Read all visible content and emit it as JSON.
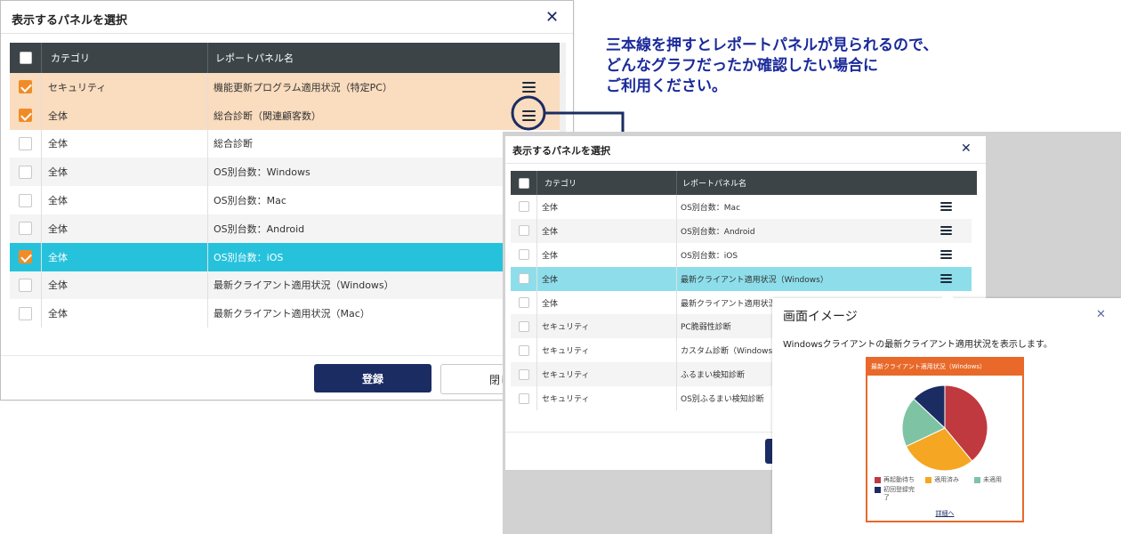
{
  "annotation": {
    "line1": "三本線を押すとレポートパネルが見られるので、",
    "line2": "どんなグラフだったか確認したい場合に",
    "line3": "ご利用ください。",
    "color": "#1a2a9a"
  },
  "dialog1": {
    "title": "表示するパネルを選択",
    "header_category": "カテゴリ",
    "header_name": "レポートパネル名",
    "rows": [
      {
        "category": "セキュリティ",
        "name": "機能更新プログラム適用状況（特定PC）",
        "checked": true
      },
      {
        "category": "全体",
        "name": "総合診断（関連顧客数）",
        "checked": true
      },
      {
        "category": "全体",
        "name": "総合診断",
        "checked": false
      },
      {
        "category": "全体",
        "name": "OS別台数：Windows",
        "checked": false
      },
      {
        "category": "全体",
        "name": "OS別台数：Mac",
        "checked": false
      },
      {
        "category": "全体",
        "name": "OS別台数：Android",
        "checked": false
      },
      {
        "category": "全体",
        "name": "OS別台数：iOS",
        "checked": true
      },
      {
        "category": "全体",
        "name": "最新クライアント適用状況（Windows）",
        "checked": false
      },
      {
        "category": "全体",
        "name": "最新クライアント適用状況（Mac）",
        "checked": false
      }
    ],
    "register_label": "登録",
    "close_label": "閉じ"
  },
  "dialog2": {
    "title": "表示するパネルを選択",
    "header_category": "カテゴリ",
    "header_name": "レポートパネル名",
    "rows": [
      {
        "category": "全体",
        "name": "OS別台数：Mac"
      },
      {
        "category": "全体",
        "name": "OS別台数：Android"
      },
      {
        "category": "全体",
        "name": "OS別台数：iOS"
      },
      {
        "category": "全体",
        "name": "最新クライアント適用状況（Windows）"
      },
      {
        "category": "全体",
        "name": "最新クライアント適用状況（"
      },
      {
        "category": "セキュリティ",
        "name": "PC脆弱性診断"
      },
      {
        "category": "セキュリティ",
        "name": "カスタム診断（Windows）"
      },
      {
        "category": "セキュリティ",
        "name": "ふるまい検知診断"
      },
      {
        "category": "セキュリティ",
        "name": "OS別ふるまい検知診断"
      }
    ]
  },
  "preview": {
    "title": "画面イメージ",
    "description": "Windowsクライアントの最新クライアント適用状況を表示します。",
    "card_title": "最新クライアント適用状況（Windows）",
    "card_color": "#e8692a",
    "legend": [
      {
        "label": "再起動待ち",
        "color": "#c0393f"
      },
      {
        "label": "適用済み",
        "color": "#f5a623"
      },
      {
        "label": "未適用",
        "color": "#7ec4a4"
      },
      {
        "label": "初回登録完",
        "color": "#1b2c63"
      },
      {
        "label": "了",
        "color": ""
      }
    ],
    "details_link": "詳細へ"
  },
  "chart_data": {
    "type": "pie",
    "categories": [
      "再起動待ち",
      "適用済み",
      "未適用",
      "初回登録完了"
    ],
    "values": [
      39,
      29,
      19,
      13
    ],
    "colors": [
      "#c0393f",
      "#f5a623",
      "#7ec4a4",
      "#1b2c63"
    ]
  },
  "colors": {
    "selected_orange_row": "#fadcbf",
    "selected_cyan_row": "#26c2dc",
    "selected_cyan_row_2": "#8ddeea",
    "alt_row": "#f4f4f4",
    "header": "#3d4447",
    "navy": "#1b2c63"
  }
}
